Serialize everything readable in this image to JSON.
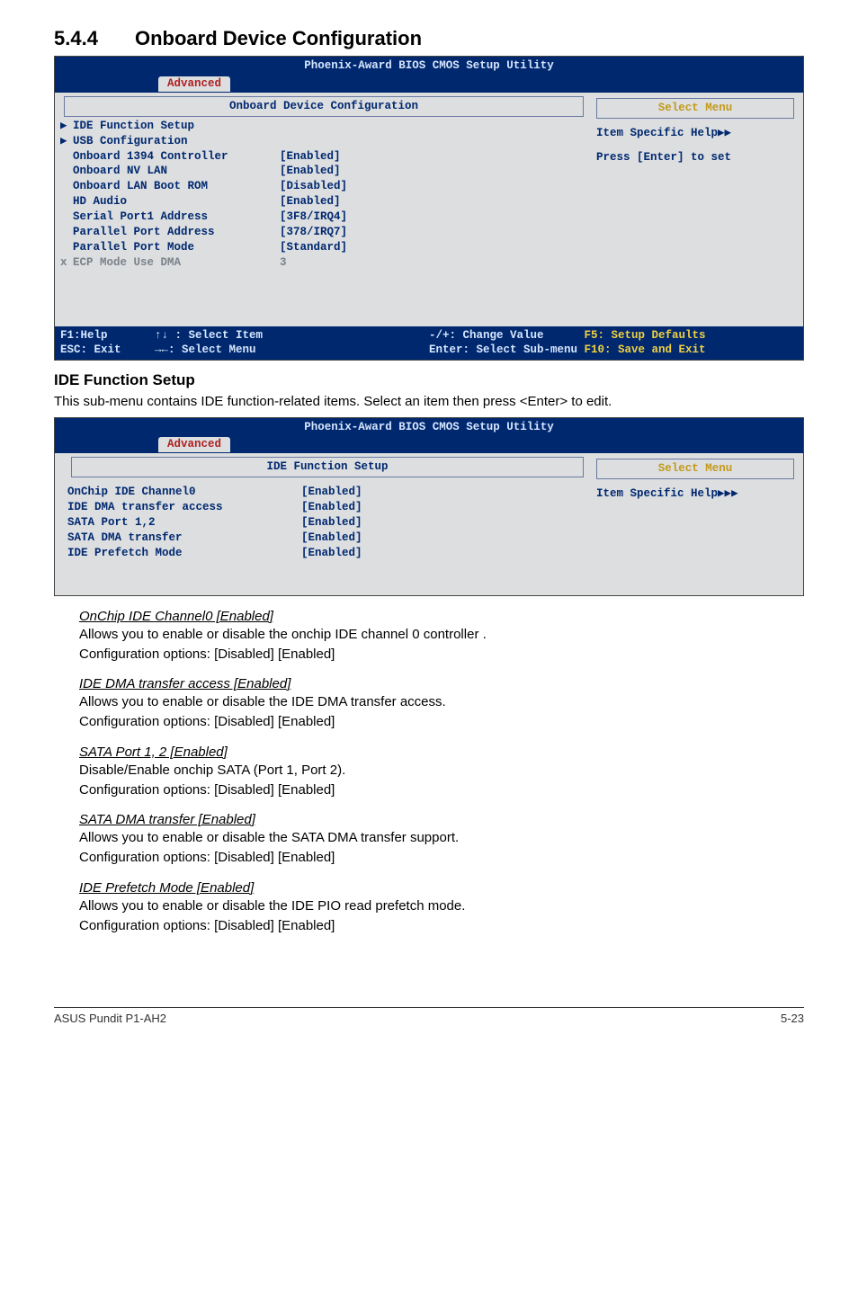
{
  "heading": {
    "num": "5.4.4",
    "title": "Onboard Device Configuration"
  },
  "bios1": {
    "title": "Phoenix-Award BIOS CMOS Setup Utility",
    "tab": "Advanced",
    "left_title": "Onboard Device Configuration",
    "right_title": "Select Menu",
    "items": [
      {
        "arrow": "▶",
        "label": "IDE Function Setup",
        "value": "",
        "dim": false
      },
      {
        "arrow": "▶",
        "label": "USB Configuration",
        "value": "",
        "dim": false
      },
      {
        "arrow": "",
        "label": "Onboard 1394 Controller",
        "value": "[Enabled]",
        "dim": false
      },
      {
        "arrow": "",
        "label": "Onboard NV LAN",
        "value": "[Enabled]",
        "dim": false
      },
      {
        "arrow": "",
        "label": "Onboard LAN Boot ROM",
        "value": "[Disabled]",
        "dim": false
      },
      {
        "arrow": "",
        "label": "HD Audio",
        "value": "[Enabled]",
        "dim": false
      },
      {
        "arrow": "",
        "label": "Serial Port1 Address",
        "value": "[3F8/IRQ4]",
        "dim": false
      },
      {
        "arrow": "",
        "label": "Parallel Port Address",
        "value": "[378/IRQ7]",
        "dim": false
      },
      {
        "arrow": "",
        "label": "Parallel Port Mode",
        "value": "[Standard]",
        "dim": false
      },
      {
        "arrow": "x",
        "label": "ECP Mode Use DMA",
        "value": "3",
        "dim": true
      }
    ],
    "help1": "Item Specific Help▶▶",
    "help2": "Press [Enter] to set",
    "foot_l1": "F1:Help       ↑↓ : Select Item",
    "foot_l2": "ESC: Exit     →←: Select Menu",
    "foot_r1": "-/+: Change Value      F5: Setup Defaults",
    "foot_r2": "Enter: Select Sub-menu F10: Save and Exit"
  },
  "idefs": {
    "heading": "IDE Function Setup",
    "desc": "This sub-menu contains IDE function-related items. Select an item then press <Enter> to edit."
  },
  "bios2": {
    "title": "Phoenix-Award BIOS CMOS Setup Utility",
    "tab": "Advanced",
    "left_title": "IDE Function Setup",
    "right_title": "Select Menu",
    "items": [
      {
        "label": "OnChip IDE Channel0",
        "value": "[Enabled]"
      },
      {
        "label": "IDE DMA transfer access",
        "value": "[Enabled]"
      },
      {
        "label": "SATA Port 1,2",
        "value": "[Enabled]"
      },
      {
        "label": "SATA DMA transfer",
        "value": "[Enabled]"
      },
      {
        "label": "IDE Prefetch Mode",
        "value": "[Enabled]"
      }
    ],
    "help1": "Item Specific Help▶▶▶"
  },
  "subs": [
    {
      "title": "OnChip IDE Channel0 [Enabled]",
      "l1": "Allows you to enable or disable the onchip IDE channel 0 controller .",
      "l2": "Configuration options: [Disabled] [Enabled]"
    },
    {
      "title": "IDE DMA transfer access [Enabled]",
      "l1": "Allows you to enable or disable the IDE DMA transfer access.",
      "l2": "Configuration options: [Disabled] [Enabled]"
    },
    {
      "title": "SATA Port 1, 2 [Enabled]",
      "l1": "Disable/Enable onchip SATA (Port 1, Port 2).",
      "l2": "Configuration options: [Disabled] [Enabled]"
    },
    {
      "title": "SATA DMA transfer [Enabled]",
      "l1": "Allows you to enable or disable the SATA DMA transfer support.",
      "l2": "Configuration options: [Disabled] [Enabled]"
    },
    {
      "title": "IDE Prefetch Mode [Enabled]",
      "l1": "Allows you to enable or disable the IDE PIO read prefetch mode.",
      "l2": "Configuration options: [Disabled] [Enabled]"
    }
  ],
  "footer": {
    "left": "ASUS Pundit P1-AH2",
    "right": "5-23"
  }
}
